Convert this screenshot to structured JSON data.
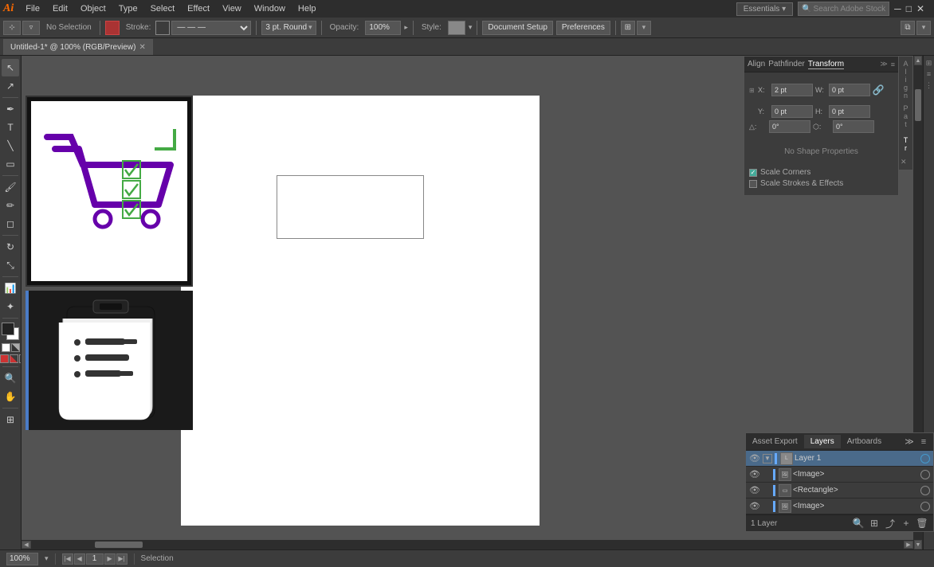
{
  "app": {
    "logo": "Ai",
    "title": "Untitled-1* @ 100% (RGB/Preview)"
  },
  "menu": {
    "items": [
      "File",
      "Edit",
      "Object",
      "Type",
      "Select",
      "Effect",
      "View",
      "Window",
      "Help"
    ]
  },
  "toolbar": {
    "no_selection": "No Selection",
    "stroke_label": "Stroke:",
    "pt_round": "3 pt. Round",
    "opacity_label": "Opacity:",
    "opacity_value": "100%",
    "style_label": "Style:",
    "doc_setup_btn": "Document Setup",
    "preferences_btn": "Preferences",
    "mode_icon": "⊞",
    "screen_icon": "☐"
  },
  "transform_panel": {
    "tabs": [
      "Align",
      "Pathfinder",
      "Transform"
    ],
    "active_tab": "Transform",
    "x_label": "X:",
    "x_value": "2 pt",
    "y_label": "Y:",
    "y_value": "0 pt",
    "w_label": "W:",
    "w_value": "0 pt",
    "h_label": "H:",
    "h_value": "0 pt",
    "rotate_label": "△:",
    "rotate_value": "0°",
    "shear_label": "⬡:",
    "shear_value": "0°",
    "no_shape": "No Shape Properties",
    "scale_corners": "Scale Corners",
    "scale_strokes": "Scale Strokes & Effects"
  },
  "float_panels": {
    "tabs": [
      "Align",
      "Pathfinder",
      "Transform"
    ],
    "active": "Transform",
    "align_tab": {
      "rows": [
        [
          "⊢",
          "⊣",
          "⋮",
          "⊤",
          "⊥",
          "—"
        ],
        [
          "↔",
          "↕",
          "⊞",
          "⊠"
        ]
      ]
    }
  },
  "layers_panel": {
    "tabs": [
      "Asset Export",
      "Layers",
      "Artboards"
    ],
    "active_tab": "Layers",
    "layers": [
      {
        "id": 1,
        "name": "Layer 1",
        "type": "layer",
        "expanded": true,
        "highlighted": true
      },
      {
        "id": 2,
        "name": "<Image>",
        "type": "image",
        "indent": 1
      },
      {
        "id": 3,
        "name": "<Rectangle>",
        "type": "rect",
        "indent": 1
      },
      {
        "id": 4,
        "name": "<Image>",
        "type": "image",
        "indent": 1
      }
    ],
    "footer_label": "1 Layer"
  },
  "status_bar": {
    "zoom": "100%",
    "artboard_nav": "◀ ▶",
    "artboard_num": "1",
    "tool": "Selection"
  },
  "colors": {
    "accent_blue": "#4a7cc7",
    "layer_highlight": "#4a6a8a",
    "layer_dot_blue": "#2299cc",
    "layer1_color": "#66aaff",
    "image_color": "#aa66ff",
    "rect_color": "#66aaff"
  }
}
